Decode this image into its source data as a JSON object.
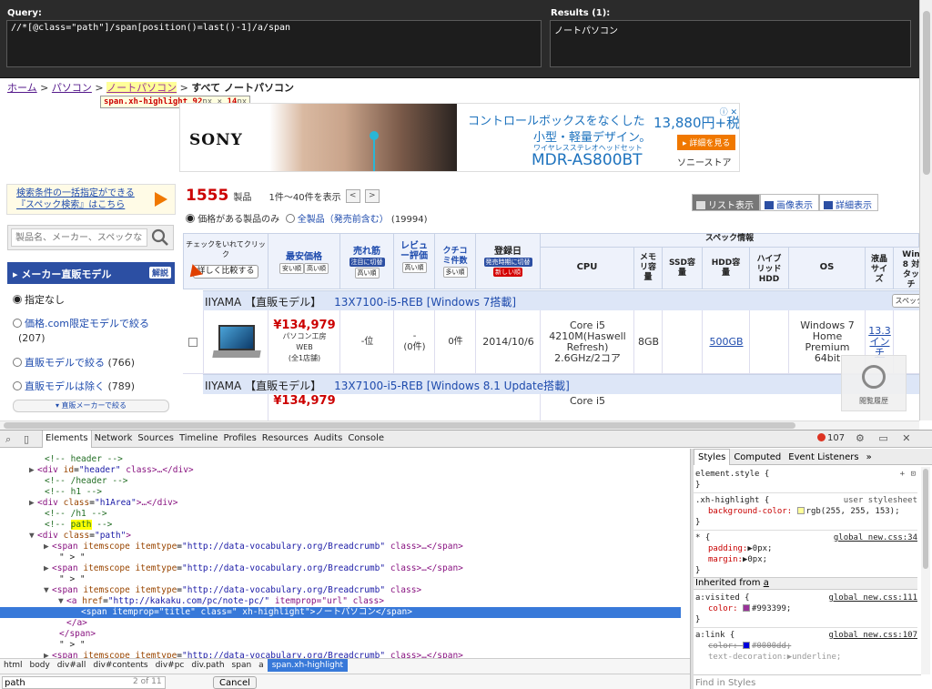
{
  "xpath_helper": {
    "query_label": "Query:",
    "query_value": "//*[@class=\"path\"]/span[position()=last()-1]/a/span",
    "results_label": "Results (1):",
    "results_value": "ノートパソコン"
  },
  "breadcrumb": {
    "home": "ホーム",
    "sep1": ">",
    "pc": "パソコン",
    "sep2": ">",
    "note_pc": "ノートパソコン",
    "sep3": ">",
    "current": "すべて ノートパソコン"
  },
  "highlight_tooltip": {
    "selector": "span.xh-highlight",
    "width": "92",
    "height": "14",
    "unit": "px",
    "times": "×"
  },
  "ad_banner": {
    "brand": "SONY",
    "line1": "コントロールボックスをなくした",
    "line2": "小型・軽量デザイン。",
    "line3": "ワイヤレスステレオヘッドセット",
    "model": "MDR-AS800BT",
    "price": "13,880円+税",
    "detail_button": "▸ 詳細を見る",
    "store": "ソニーストア",
    "ad_marks": "ⓘ ✕"
  },
  "sidebar": {
    "spec_search_line1": "検索条件の一括指定ができる",
    "spec_search_line2": "『スペック検索』はこちら",
    "search_placeholder": "製品名、メーカー、スペックな",
    "maker_title": "▸ メーカー直販モデル",
    "maker_help": "解説",
    "options": [
      {
        "label": "指定なし",
        "count": ""
      },
      {
        "label": "価格.com限定モデルで絞る",
        "count": "(207)"
      },
      {
        "label": "直販モデルで絞る",
        "count": "(766)"
      },
      {
        "label": "直販モデルは除く",
        "count": "(789)"
      }
    ],
    "maker_more": "▾ 直販メーカーで絞る"
  },
  "results": {
    "count": "1555",
    "count_unit": "製品",
    "range": "1件〜40件を表示",
    "prev": "<",
    "next": ">",
    "filter_priced": "価格がある製品のみ",
    "filter_all": "全製品（発売前含む）",
    "filter_all_count": "(19994)"
  },
  "view_tabs": [
    "リスト表示",
    "画像表示",
    "詳細表示"
  ],
  "table": {
    "check_header": "チェックをいれてクリック",
    "compare_button": "詳しく比較する",
    "spec_header": "スペック情報",
    "price_col": "最安価格",
    "price_sort_low": "安い順",
    "price_sort_high": "高い順",
    "sales_col": "売れ筋",
    "sales_tag": "注目に切替",
    "sales_sort": "高い順",
    "review_col": "レビュー評価",
    "review_sort": "高い順",
    "kuchikomi_col": "クチコミ件数",
    "kuchikomi_sort": "多い順",
    "date_col": "登録日",
    "date_tag": "発売時期に切替",
    "date_sort": "新しい順",
    "cpu_col": "CPU",
    "memory_col": "メモリ容量",
    "ssd_col": "SSD容量",
    "hdd_col": "HDD容量",
    "hybrid_col": "ハイブリッドHDD",
    "os_col": "OS",
    "lcd_col": "液晶サイズ",
    "win8_col": "Win 8 対 タッチ",
    "spec_more": "スペックをも",
    "rows": [
      {
        "maker": "IIYAMA 【直販モデル】",
        "model": "13X7100-i5-REB [Windows 7搭載]",
        "price": "¥134,979",
        "shop1": "パソコン工房",
        "shop2": "WEB",
        "shops": "(全1店舗)",
        "rank": "-位",
        "review": "-",
        "review_count": "(0件)",
        "kuchikomi": "0件",
        "date": "2014/10/6",
        "cpu": "Core i5 4210M(Haswell Refresh) 2.6GHz/2コア",
        "memory": "8GB",
        "hdd": "500GB",
        "os": "Windows 7 Home Premium 64bit",
        "lcd": "13.3インチ"
      },
      {
        "maker": "IIYAMA 【直販モデル】",
        "model": "13X7100-i5-REB [Windows 8.1 Update搭載]",
        "price": "¥134,979",
        "cpu": "Core i5"
      }
    ]
  },
  "history_widget": "閲覧履歴",
  "devtools": {
    "tabs": [
      "Elements",
      "Network",
      "Sources",
      "Timeline",
      "Profiles",
      "Resources",
      "Audits",
      "Console"
    ],
    "error_count": "107",
    "toolbar_icons": "⚙ ▭ ✕",
    "dom_lines": [
      {
        "indent": 5,
        "tri": "",
        "kind": "comment",
        "text": "<!-- header -->"
      },
      {
        "indent": 4,
        "tri": "▶",
        "kind": "tag",
        "tag": "div",
        "attr": "id",
        "val": "header",
        "rest": " class>…</div>"
      },
      {
        "indent": 5,
        "tri": "",
        "kind": "comment",
        "text": "<!-- /header -->"
      },
      {
        "indent": 5,
        "tri": "",
        "kind": "comment",
        "text": "<!-- h1 -->"
      },
      {
        "indent": 4,
        "tri": "▶",
        "kind": "tag",
        "tag": "div",
        "attr": "class",
        "val": "h1Area",
        "rest": ">…</div>"
      },
      {
        "indent": 5,
        "tri": "",
        "kind": "comment",
        "text": "<!-- /h1 -->"
      },
      {
        "indent": 5,
        "tri": "",
        "kind": "comment-hl",
        "pre": "<!-- ",
        "hl": "path",
        "post": " -->"
      },
      {
        "indent": 4,
        "tri": "▼",
        "kind": "tag",
        "tag": "div",
        "attr": "class",
        "val": "path",
        "rest": ">"
      },
      {
        "indent": 6,
        "tri": "▶",
        "kind": "tag",
        "tag": "span",
        "attr": "itemscope itemtype",
        "val": "http://data-vocabulary.org/Breadcrumb",
        "rest": " class>…</span>"
      },
      {
        "indent": 7,
        "tri": "",
        "kind": "text",
        "text": "\" > \""
      },
      {
        "indent": 6,
        "tri": "▶",
        "kind": "tag",
        "tag": "span",
        "attr": "itemscope itemtype",
        "val": "http://data-vocabulary.org/Breadcrumb",
        "rest": " class>…</span>"
      },
      {
        "indent": 7,
        "tri": "",
        "kind": "text",
        "text": "\" > \""
      },
      {
        "indent": 6,
        "tri": "▼",
        "kind": "tag",
        "tag": "span",
        "attr": "itemscope itemtype",
        "val": "http://data-vocabulary.org/Breadcrumb",
        "rest": " class>"
      },
      {
        "indent": 8,
        "tri": "▼",
        "kind": "tag",
        "tag": "a",
        "attr": "href",
        "val": "http://kakaku.com/pc/note-pc/",
        "rest": " itemprop=\"url\" class>"
      },
      {
        "indent": 10,
        "tri": "",
        "kind": "selected",
        "text": "<span itemprop=\"title\" class=\" xh-highlight\">ノートパソコン</span>"
      },
      {
        "indent": 8,
        "tri": "",
        "kind": "close",
        "text": "</a>"
      },
      {
        "indent": 7,
        "tri": "",
        "kind": "close",
        "text": "</span>"
      },
      {
        "indent": 7,
        "tri": "",
        "kind": "text",
        "text": "\" > \""
      },
      {
        "indent": 6,
        "tri": "▶",
        "kind": "tag",
        "tag": "span",
        "attr": "itemscope itemtype",
        "val": "http://data-vocabulary.org/Breadcrumb",
        "rest": " class>…</span>"
      }
    ],
    "crumbs": [
      "html",
      "body",
      "div#all",
      "div#contents",
      "div#pc",
      "div.path",
      "span",
      "a",
      "span.xh-highlight"
    ],
    "find_value": "path",
    "find_count": "2 of 11",
    "cancel": "Cancel",
    "styles_tabs": [
      "Styles",
      "Computed",
      "Event Listeners",
      "»"
    ],
    "styles": {
      "element_style": "element.style {",
      "close": "}",
      "rule1_selector": ".xh-highlight {",
      "rule1_src": "user stylesheet",
      "rule1_prop": "background-color:",
      "rule1_val": "rgb(255, 255, 153);",
      "rule1_color": "#ffff99",
      "rule2_selector": "* {",
      "rule2_src": "global_new.css:34",
      "rule2_p1": "padding:",
      "rule2_v1": "▶0px;",
      "rule2_p2": "margin:",
      "rule2_v2": "▶0px;",
      "inherited": "Inherited from",
      "inherited_el": "a",
      "rule3_selector": "a:visited {",
      "rule3_src": "global_new.css:111",
      "rule3_prop": "color:",
      "rule3_val": "#993399;",
      "rule3_color": "#993399",
      "rule4_selector": "a:link {",
      "rule4_src": "global_new.css:107",
      "rule4_prop": "color:",
      "rule4_val": "#0000dd;",
      "rule4_color": "#0000dd",
      "rule4_p2": "text-decoration:",
      "rule4_v2": "▶underline;",
      "find_placeholder": "Find in Styles",
      "plus_icon": "+"
    }
  }
}
